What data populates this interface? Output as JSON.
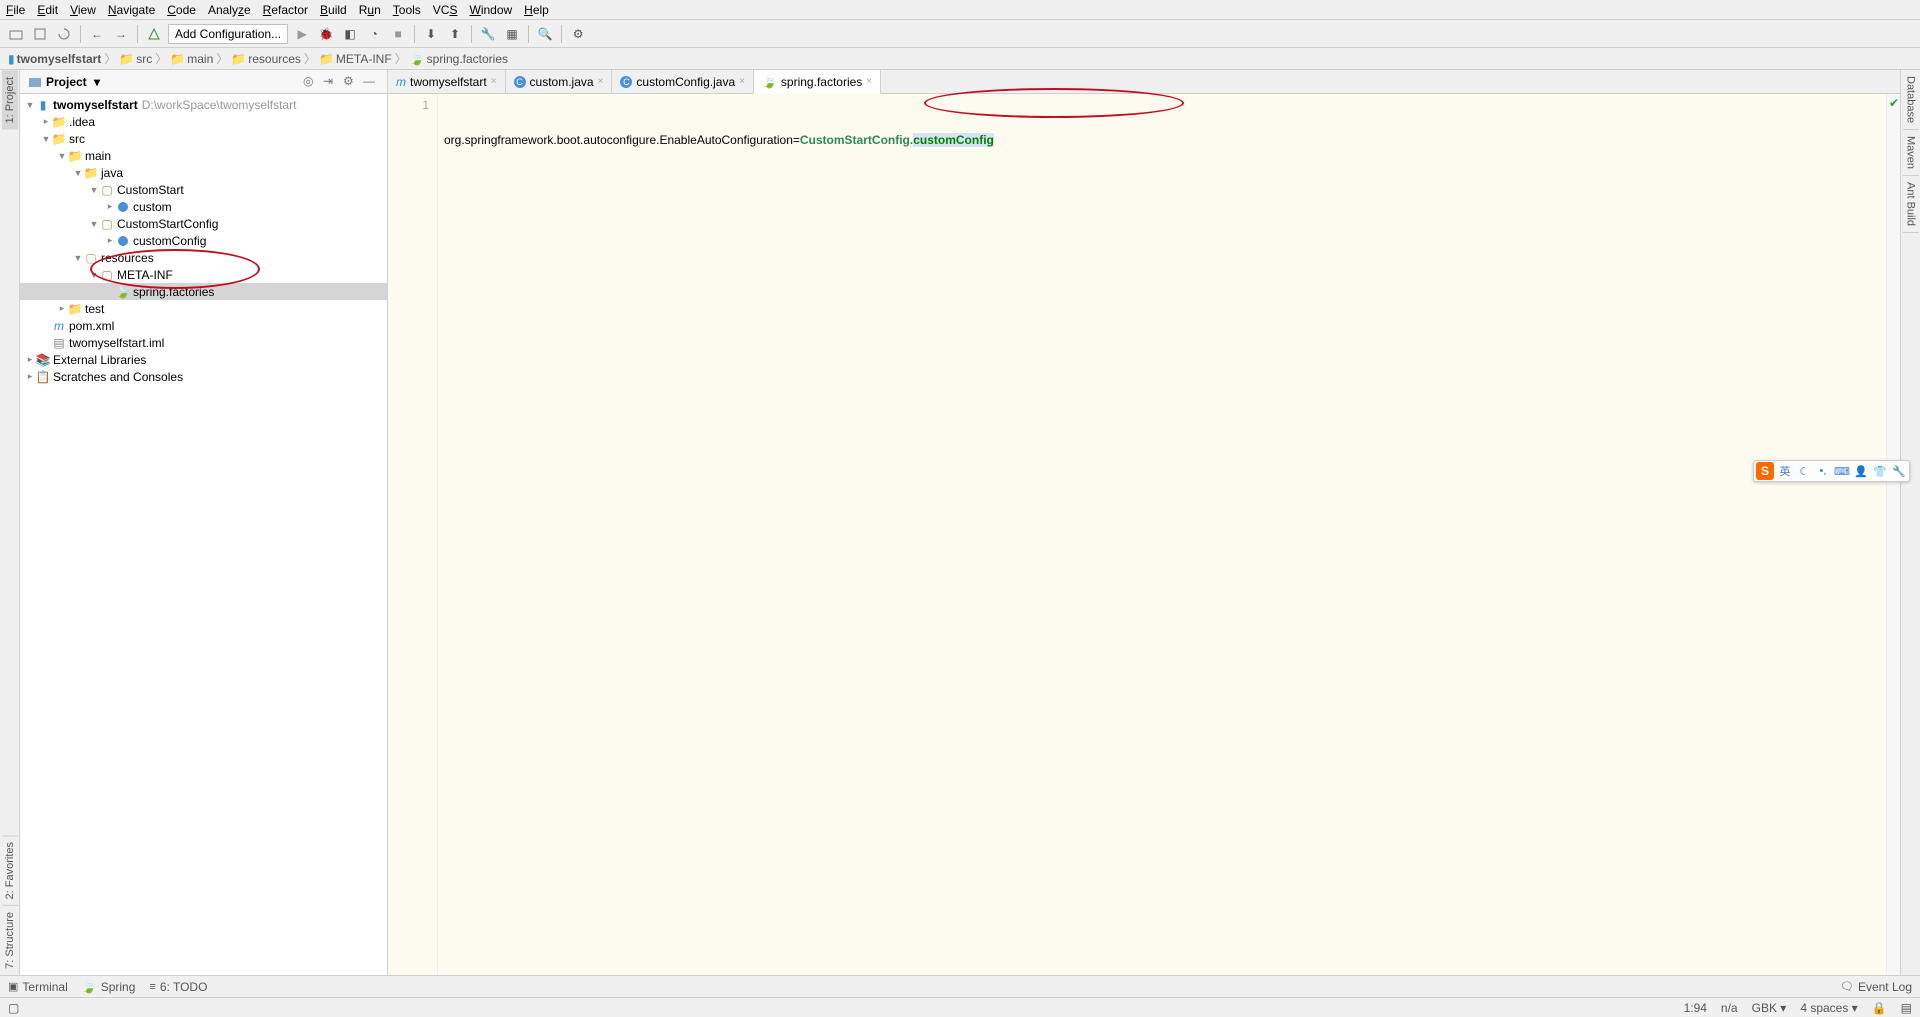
{
  "menubar": [
    "File",
    "Edit",
    "View",
    "Navigate",
    "Code",
    "Analyze",
    "Refactor",
    "Build",
    "Run",
    "Tools",
    "VCS",
    "Window",
    "Help"
  ],
  "toolbar": {
    "config_placeholder": "Add Configuration..."
  },
  "breadcrumb": [
    {
      "label": "twomyselfstart",
      "icon": "module"
    },
    {
      "label": "src",
      "icon": "folder"
    },
    {
      "label": "main",
      "icon": "folder"
    },
    {
      "label": "resources",
      "icon": "folder"
    },
    {
      "label": "META-INF",
      "icon": "folder"
    },
    {
      "label": "spring.factories",
      "icon": "file"
    }
  ],
  "project": {
    "title": "Project",
    "root": {
      "name": "twomyselfstart",
      "path": "D:\\workSpace\\twomyselfstart"
    },
    "tree": [
      {
        "name": ".idea",
        "depth": 1,
        "icon": "folder",
        "arrow": "right"
      },
      {
        "name": "src",
        "depth": 1,
        "icon": "folder-blue",
        "arrow": "down"
      },
      {
        "name": "main",
        "depth": 2,
        "icon": "folder-blue",
        "arrow": "down"
      },
      {
        "name": "java",
        "depth": 3,
        "icon": "folder-blue",
        "arrow": "down"
      },
      {
        "name": "CustomStart",
        "depth": 4,
        "icon": "pkg",
        "arrow": "down"
      },
      {
        "name": "custom",
        "depth": 5,
        "icon": "class",
        "arrow": "right"
      },
      {
        "name": "CustomStartConfig",
        "depth": 4,
        "icon": "pkg",
        "arrow": "down"
      },
      {
        "name": "customConfig",
        "depth": 5,
        "icon": "class",
        "arrow": "right"
      },
      {
        "name": "resources",
        "depth": 3,
        "icon": "res",
        "arrow": "down"
      },
      {
        "name": "META-INF",
        "depth": 4,
        "icon": "pkg",
        "arrow": "down",
        "circled": true
      },
      {
        "name": "spring.factories",
        "depth": 5,
        "icon": "leaf",
        "arrow": "",
        "selected": true,
        "circled": true
      },
      {
        "name": "test",
        "depth": 2,
        "icon": "folder-green",
        "arrow": "right"
      },
      {
        "name": "pom.xml",
        "depth": 1,
        "icon": "maven",
        "arrow": ""
      },
      {
        "name": "twomyselfstart.iml",
        "depth": 1,
        "icon": "iml",
        "arrow": ""
      }
    ],
    "ext1": "External Libraries",
    "ext2": "Scratches and Consoles"
  },
  "tabs": [
    {
      "label": "twomyselfstart",
      "icon": "m",
      "active": false
    },
    {
      "label": "custom.java",
      "icon": "c",
      "active": false
    },
    {
      "label": "customConfig.java",
      "icon": "c",
      "active": false
    },
    {
      "label": "spring.factories",
      "icon": "leaf",
      "active": true
    }
  ],
  "editor": {
    "line_number": "1",
    "prefix": "org.springframework.boot.autoconfigure.EnableAutoConfiguration=",
    "class1": "CustomStartConfig.",
    "class2": "customConfig"
  },
  "left_tabs": [
    "1: Project",
    "2: Favorites",
    "7: Structure"
  ],
  "right_tabs": [
    "Database",
    "Maven",
    "Ant Build"
  ],
  "bottom": {
    "terminal": "Terminal",
    "spring": "Spring",
    "todo": "6: TODO",
    "eventlog": "Event Log"
  },
  "status": {
    "pos": "1:94",
    "readonly": "n/a",
    "encoding": "GBK",
    "indent": "4 spaces"
  },
  "ime": {
    "lang": "英"
  }
}
